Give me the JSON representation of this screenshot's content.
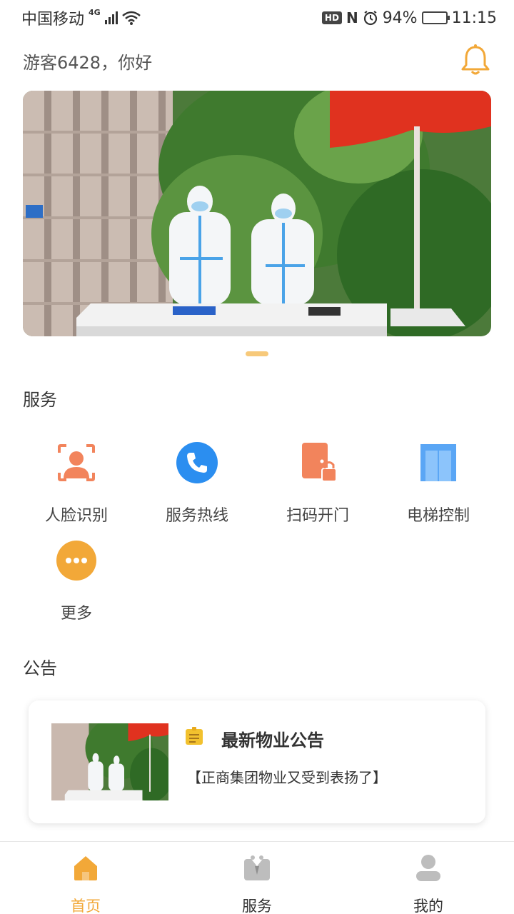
{
  "status_bar": {
    "carrier": "中国移动",
    "network": "4G",
    "battery": "94%",
    "time": "11:15"
  },
  "header": {
    "greeting": "游客6428，你好",
    "bell_icon": "bell-icon"
  },
  "banner": {
    "active_index": 0,
    "image": "banner-photo"
  },
  "services": {
    "title": "服务",
    "items": [
      {
        "label": "人脸识别",
        "icon": "face-recognition-icon",
        "color": "#f2845c"
      },
      {
        "label": "服务热线",
        "icon": "phone-icon",
        "color": "#2b8ef0"
      },
      {
        "label": "扫码开门",
        "icon": "door-lock-icon",
        "color": "#f2845c"
      },
      {
        "label": "电梯控制",
        "icon": "elevator-icon",
        "color": "#5aa6f5"
      },
      {
        "label": "更多",
        "icon": "more-icon",
        "color": "#f2a838"
      }
    ]
  },
  "notices": {
    "title": "公告",
    "card": {
      "title": "最新物业公告",
      "subtitle": "【正商集团物业又受到表扬了】"
    }
  },
  "tabbar": {
    "items": [
      {
        "label": "首页",
        "icon": "home-icon",
        "active": true
      },
      {
        "label": "服务",
        "icon": "service-icon",
        "active": false
      },
      {
        "label": "我的",
        "icon": "profile-icon",
        "active": false
      }
    ],
    "active_color": "#f2a838"
  }
}
